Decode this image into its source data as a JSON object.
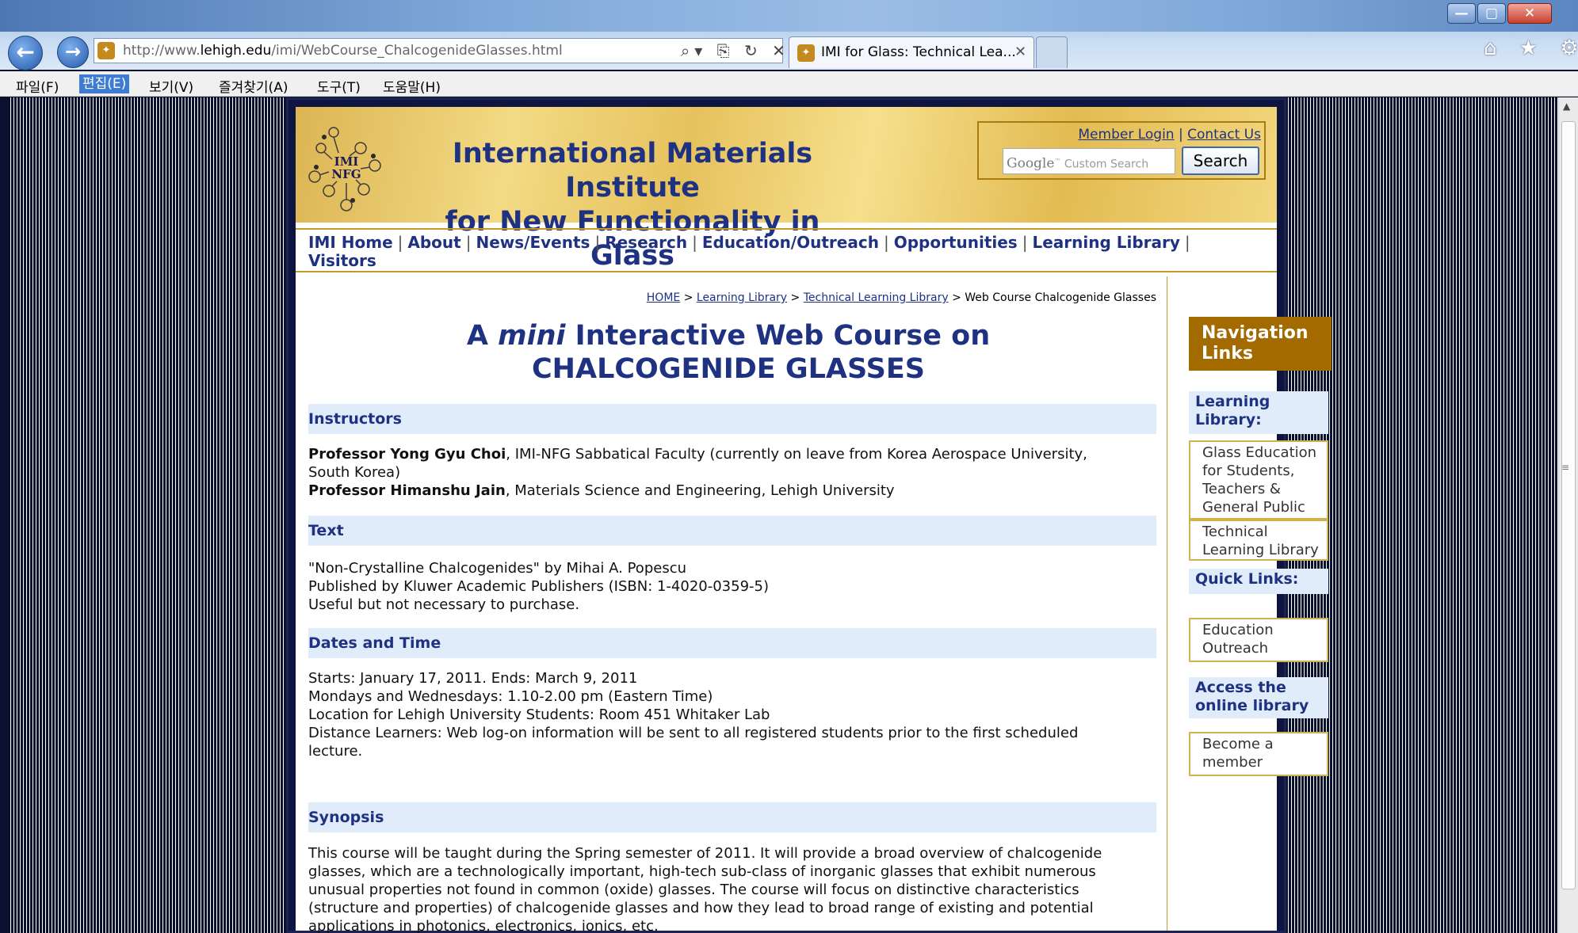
{
  "browser": {
    "url_prefix": "http://www.",
    "url_domain": "lehigh.edu",
    "url_path": "/imi/WebCourse_ChalcogenideGlasses.html",
    "address_tools": "⌕▾ ⎘ ↻ ✕",
    "tab_title": "IMI for Glass: Technical Lea...",
    "tab_close": "✕",
    "window_min": "—",
    "window_max": "▢",
    "window_close": "✕",
    "right_icons": "⌂ ★ ⚙",
    "back_arrow": "←",
    "forward_arrow": "→"
  },
  "menu": {
    "file": "파일(F)",
    "edit": "편집(E)",
    "view": "보기(V)",
    "favorites": "즐겨찾기(A)",
    "tools": "도구(T)",
    "help": "도움말(H)"
  },
  "header": {
    "logo_line1": "IMI",
    "logo_line2": "NFG",
    "title_line1": "International Materials Institute",
    "title_line2": "for New Functionality in Glass",
    "member_login": "Member Login",
    "separator": "|",
    "contact_us": "Contact Us",
    "search_placeholder_brand": "Google",
    "search_placeholder": "Custom Search",
    "search_button": "Search"
  },
  "mainnav": {
    "items": [
      "IMI Home",
      "About",
      "News/Events",
      "Research",
      "Education/Outreach",
      "Opportunities",
      "Learning Library",
      "Visitors"
    ],
    "separator": "|"
  },
  "breadcrumb": {
    "home": "HOME",
    "learning_library": "Learning Library",
    "technical": "Technical Learning Library",
    "current": "Web Course Chalcogenide Glasses",
    "sep": ">"
  },
  "course": {
    "title_pre": "A ",
    "title_em": "mini",
    "title_post": " Interactive Web Course on",
    "title_line2": "CHALCOGENIDE GLASSES"
  },
  "sections": {
    "instructors": {
      "heading": "Instructors",
      "p1_name": "Professor Yong Gyu Choi",
      "p1_desc": ", IMI-NFG Sabbatical Faculty (currently on leave from Korea Aerospace University, South Korea)",
      "p2_name": "Professor Himanshu Jain",
      "p2_desc": ", Materials Science and Engineering, Lehigh University"
    },
    "text": {
      "heading": "Text",
      "line1": "\"Non-Crystalline Chalcogenides\" by Mihai A. Popescu",
      "line2": "Published by Kluwer Academic Publishers (ISBN: 1-4020-0359-5)",
      "line3": "Useful but not necessary to purchase."
    },
    "dates": {
      "heading": "Dates and Time",
      "line1": "Starts: January 17, 2011. Ends: March 9, 2011",
      "line2": "Mondays and Wednesdays: 1.10-2.00 pm (Eastern Time)",
      "line3": "Location for Lehigh University Students: Room 451 Whitaker Lab",
      "line4": "Distance Learners: Web log-on information will be sent to all registered students prior to the first scheduled lecture."
    },
    "synopsis": {
      "heading": "Synopsis",
      "body": "This course will be taught during the Spring semester of 2011. It will provide a broad overview of chalcogenide glasses, which are a technologically important, high-tech sub-class of inorganic glasses that exhibit numerous unusual properties not found in common (oxide) glasses. The course will focus on distinctive characteristics (structure and properties) of chalcogenide glasses and how they lead to broad range of existing and potential applications in photonics, electronics, ionics, etc."
    }
  },
  "sidebar": {
    "heading": "Navigation Links",
    "learning_library": "Learning Library:",
    "glass_education": "Glass Education for Students, Teachers & General Public",
    "technical_library": "Technical Learning Library",
    "quick_links": "Quick Links:",
    "education_outreach": "Education Outreach",
    "access_library": "Access the online library",
    "become_member": "Become a member"
  },
  "colors": {
    "navy": "#1f3282",
    "gold": "#c79a25",
    "nav_head_bg": "#a36a00",
    "section_bg": "#e1ecfb"
  }
}
